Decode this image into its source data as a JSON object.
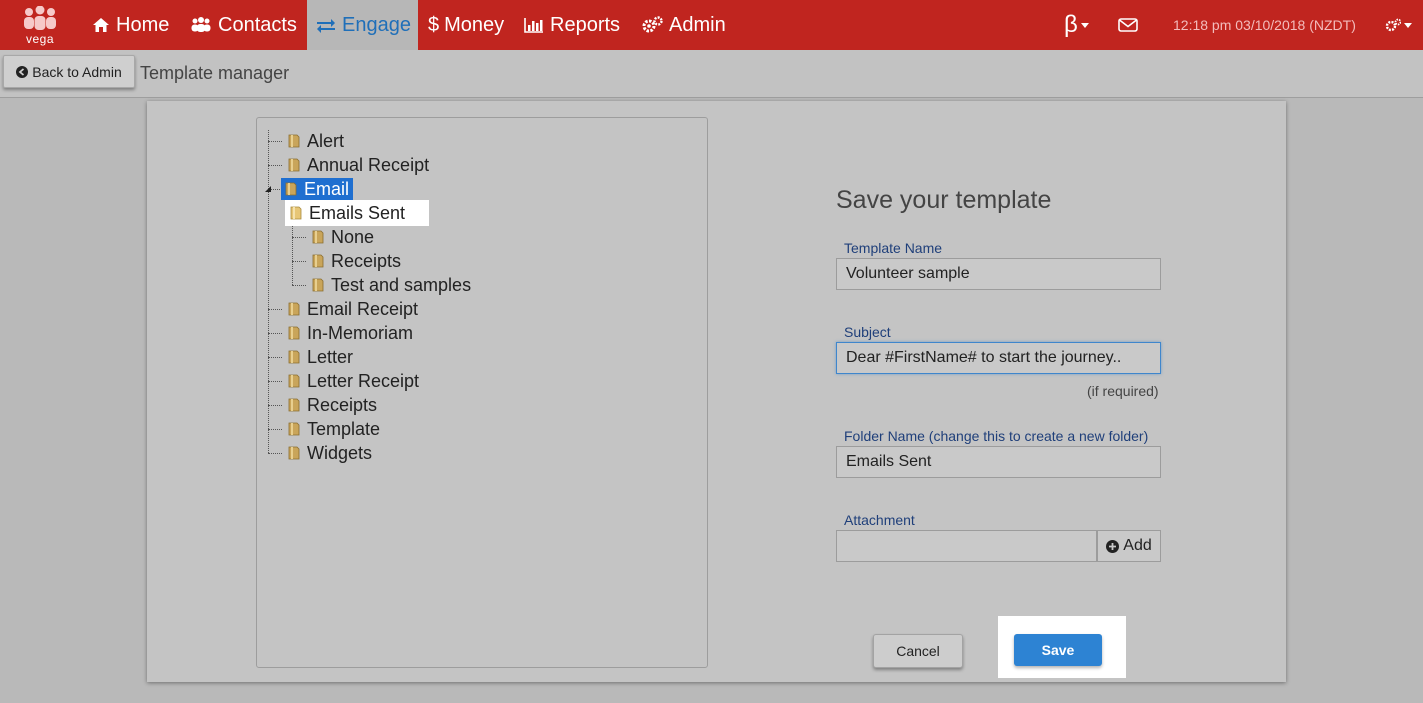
{
  "app": {
    "logo_text": "vega"
  },
  "nav": {
    "items": [
      {
        "label": "Home",
        "icon": "home-icon"
      },
      {
        "label": "Contacts",
        "icon": "users-icon"
      },
      {
        "label": "Engage",
        "icon": "exchange-icon",
        "active": true
      },
      {
        "label": "Money",
        "icon": "dollar-icon"
      },
      {
        "label": "Reports",
        "icon": "bar-chart-icon"
      },
      {
        "label": "Admin",
        "icon": "gears-icon"
      }
    ],
    "beta_label": "β",
    "datetime": "12:18 pm 03/10/2018 (NZDT)"
  },
  "subheader": {
    "back_label": "Back to Admin",
    "page_title": "Template manager"
  },
  "tree": {
    "nodes": [
      {
        "label": "Alert"
      },
      {
        "label": "Annual Receipt"
      },
      {
        "label": "Email",
        "selected": true,
        "expanded": true,
        "children": [
          {
            "label": "Emails Sent",
            "highlighted": true
          },
          {
            "label": "None"
          },
          {
            "label": "Receipts"
          },
          {
            "label": "Test and samples"
          }
        ]
      },
      {
        "label": "Email Receipt"
      },
      {
        "label": "In-Memoriam"
      },
      {
        "label": "Letter"
      },
      {
        "label": "Letter Receipt"
      },
      {
        "label": "Receipts"
      },
      {
        "label": "Template"
      },
      {
        "label": "Widgets"
      }
    ]
  },
  "form": {
    "title": "Save your template",
    "template_name": {
      "label": "Template Name",
      "value": "Volunteer sample"
    },
    "subject": {
      "label": "Subject",
      "value": "Dear #FirstName# to start the journey..",
      "hint": "(if required)"
    },
    "folder_name": {
      "label": "Folder Name (change this to create a new folder)",
      "value": "Emails Sent"
    },
    "attachment": {
      "label": "Attachment",
      "value": "",
      "add_label": "Add"
    },
    "cancel_label": "Cancel",
    "save_label": "Save"
  },
  "colors": {
    "navbar": "#c0251f",
    "accent": "#2d83d3",
    "selected": "#1f6fd0"
  }
}
